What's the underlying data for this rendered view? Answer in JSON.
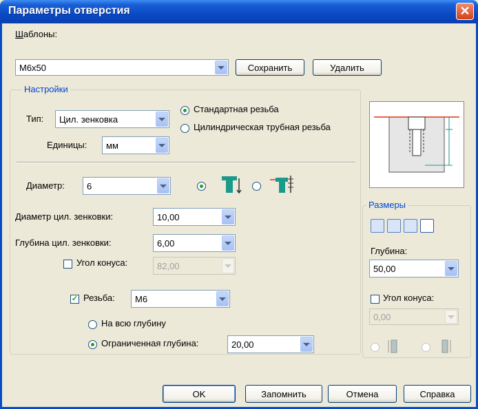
{
  "window": {
    "title": "Параметры отверстия",
    "close_glyph": "✕"
  },
  "templates": {
    "label": "Шаблоны:",
    "value": "M6x50",
    "save": "Сохранить",
    "delete": "Удалить"
  },
  "settings": {
    "group_label": "Настройки",
    "type_label": "Тип:",
    "type_value": "Цил. зенковка",
    "units_label": "Единицы:",
    "units_value": "мм",
    "thread_std": "Стандартная резьба",
    "thread_pipe": "Цилиндрическая трубная резьба",
    "diameter_label": "Диаметр:",
    "diameter_value": "6",
    "cbore_diam_label": "Диаметр цил. зенковки:",
    "cbore_diam_value": "10,00",
    "cbore_depth_label": "Глубина цил. зенковки:",
    "cbore_depth_value": "6,00",
    "taper_label": "Угол конуса:",
    "taper_value": "82,00",
    "thread_label": "Резьба:",
    "thread_value": "M6",
    "full_depth": "На всю глубину",
    "limited_depth": "Ограниченная глубина:",
    "limited_depth_value": "20,00"
  },
  "sizes": {
    "group_label": "Размеры",
    "depth_label": "Глубина:",
    "depth_value": "50,00",
    "taper_label": "Угол конуса:",
    "taper_value": "0,00"
  },
  "footer": {
    "ok": "OK",
    "remember": "Запомнить",
    "cancel": "Отмена",
    "help": "Справка"
  },
  "colors": {
    "title_bar": "#0a4ac4",
    "accent_red": "#e03010",
    "preview_teal": "#1a9a8a"
  }
}
